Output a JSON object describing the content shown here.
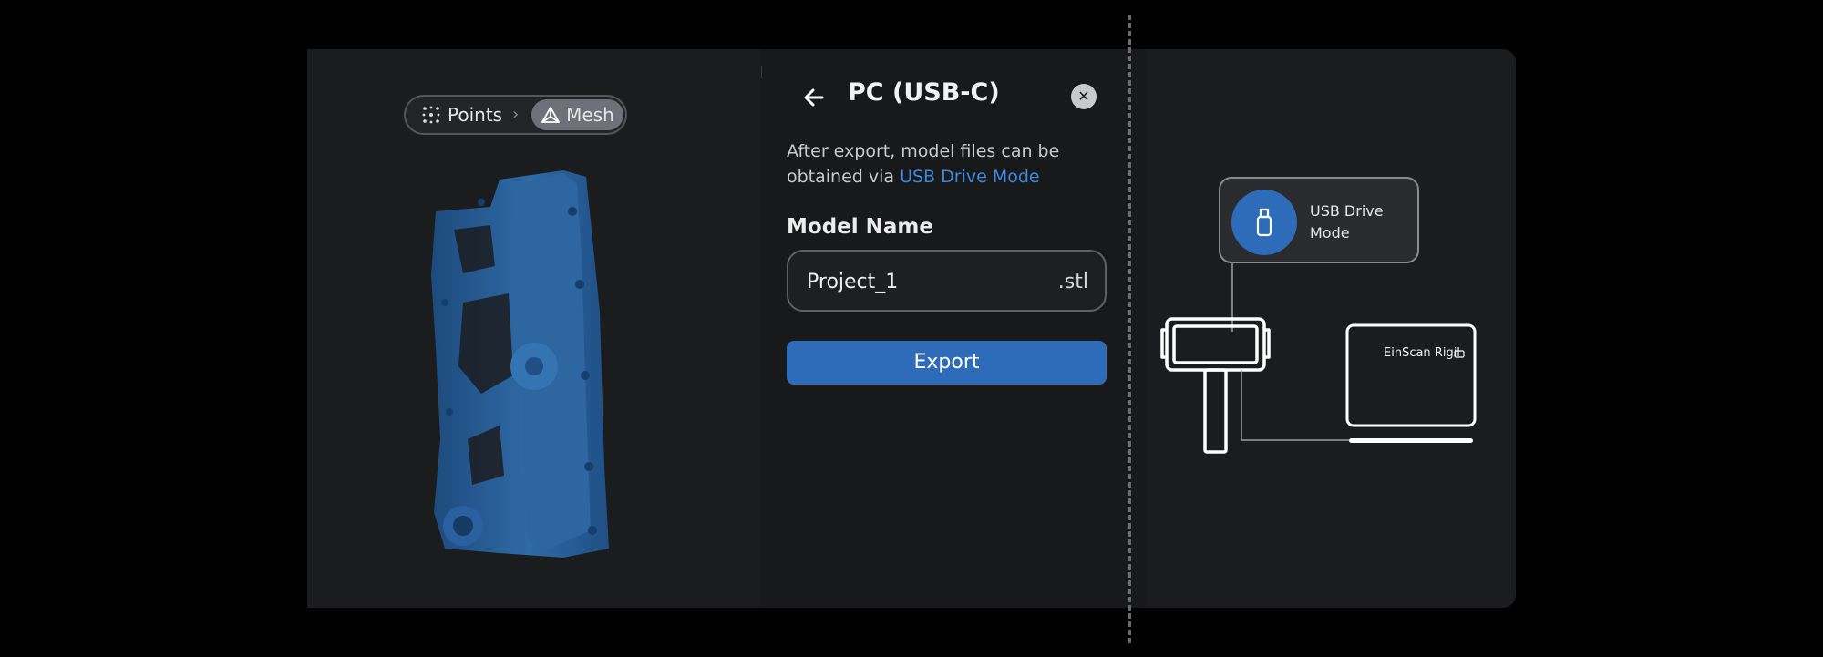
{
  "viewer": {
    "mode_toggle": {
      "points_label": "Points",
      "mesh_label": "Mesh",
      "selected": "Mesh"
    }
  },
  "export_panel": {
    "title": "PC (USB-C)",
    "description_prefix": "After export, model files can be obtained via ",
    "description_link": "USB Drive Mode",
    "model_name_label": "Model Name",
    "model_name_value": "Project_1",
    "extension": ".stl",
    "export_button_label": "Export"
  },
  "diagram": {
    "usb_card_label": "USB Drive Mode",
    "laptop_label": "EinScan Rigil"
  },
  "colors": {
    "accent": "#2e6bb8",
    "link": "#3b88e0",
    "model_blue": "#2a5f98",
    "background": "#000000",
    "card": "#1b1c1e"
  }
}
